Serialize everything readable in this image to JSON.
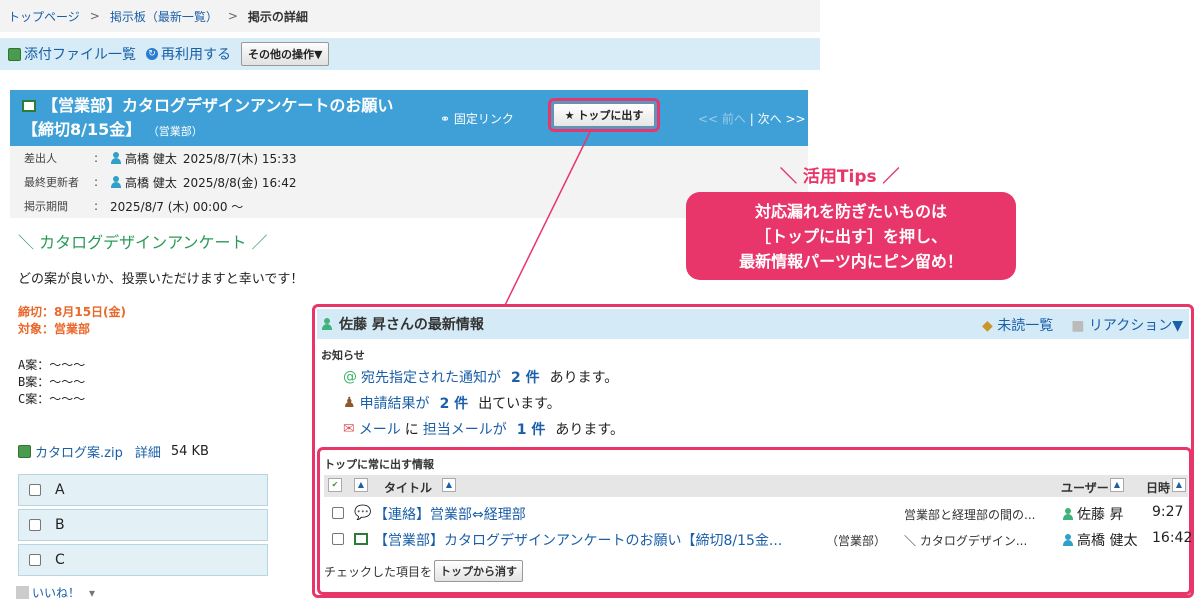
{
  "breadcrumb": {
    "top": "トップページ",
    "board": "掲示板（最新一覧）",
    "current": "掲示の詳細"
  },
  "toolbar": {
    "attachments": "添付ファイル一覧",
    "reuse": "再利用する",
    "other_ops": "その他の操作▼"
  },
  "post": {
    "title": "【営業部】カタログデザインアンケートのお願い【締切8/15金】",
    "dept": "（営業部）",
    "permalink": "固定リンク",
    "pin_button": "トップに出す",
    "prev": "<< 前へ",
    "next": "次へ >>",
    "sender_label": "差出人",
    "sender": "高橋 健太",
    "sent_at": "2025/8/7(木) 15:33",
    "updater_label": "最終更新者",
    "updater": "高橋 健太",
    "updated_at": "2025/8/8(金) 16:42",
    "period_label": "掲示期間",
    "period": "2025/8/7 (木) 00:00 〜",
    "heading": "＼ カタログデザインアンケート ／",
    "body": "どの案が良いか、投票いただけますと幸いです！",
    "deadline": "締切：8月15日(金)",
    "target": "対象：営業部",
    "plan_a": "A案：〜〜〜",
    "plan_b": "B案：〜〜〜",
    "plan_c": "C案：〜〜〜",
    "attachment_name": "カタログ案.zip",
    "attachment_detail": "詳細",
    "attachment_size": "54 KB",
    "options": [
      "A",
      "B",
      "C"
    ],
    "like": "いいね！"
  },
  "tips": {
    "head": "＼ 活用Tips ／",
    "line1": "対応漏れを防ぎたいものは",
    "line2": "［トップに出す］を押し、",
    "line3": "最新情報パーツ内にピン留め！"
  },
  "panel": {
    "title": "佐藤 昇さんの最新情報",
    "unread": "未読一覧",
    "reaction": "リアクション▼",
    "notice_label": "お知らせ",
    "n1_link": "宛先指定された通知が",
    "n1_num": "2 件",
    "n1_tail": "あります。",
    "n2_link": "申請結果が",
    "n2_num": "2 件",
    "n2_tail": "出ています。",
    "n3_pre": "メール",
    "n3_mid": "に",
    "n3_link": "担当メールが",
    "n3_num": "1 件",
    "n3_tail": "あります。",
    "pinned_label": "トップに常に出す情報",
    "col_title": "タイトル",
    "col_user": "ユーザー",
    "col_time": "日時",
    "rows": [
      {
        "title": "【連絡】営業部⇔経理部",
        "dept": "",
        "summary": "営業部と経理部の間の...",
        "user": "佐藤 昇",
        "time": "9:27"
      },
      {
        "title": "【営業部】カタログデザインアンケートのお願い【締切8/15金...",
        "dept": "（営業部）",
        "summary": "＼ カタログデザイン...",
        "user": "高橋 健太",
        "time": "16:42"
      }
    ],
    "remove_label": "チェックした項目を",
    "remove_button": "トップから消す"
  },
  "colors": {
    "accent": "#e8356a",
    "header_blue": "#3ea0d6",
    "link": "#1a5fa8"
  }
}
